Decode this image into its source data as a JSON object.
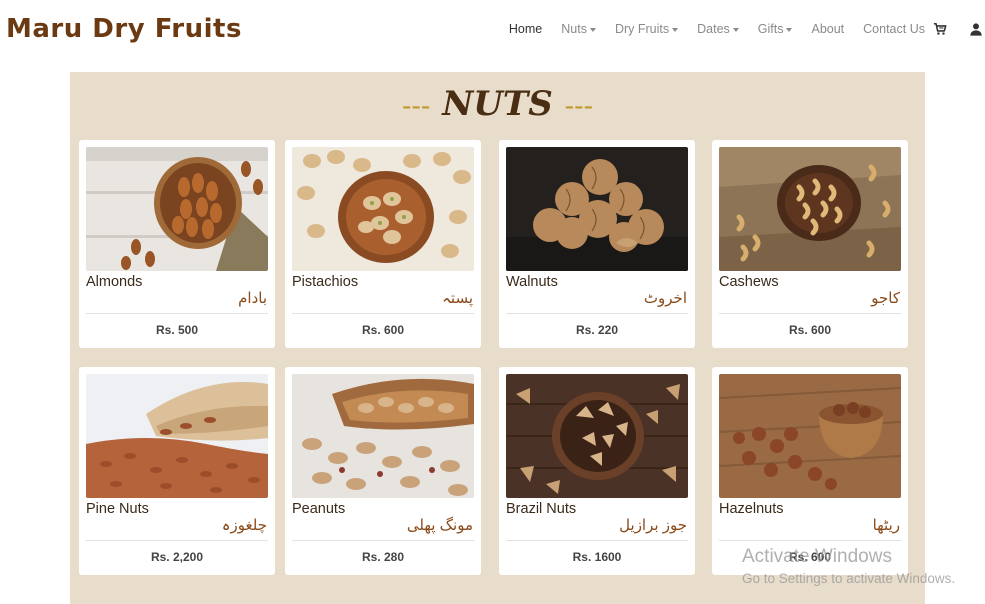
{
  "brand": "Maru Dry Fruits",
  "nav": {
    "home": "Home",
    "nuts": "Nuts",
    "dry_fruits": "Dry Fruits",
    "dates": "Dates",
    "gifts": "Gifts",
    "about": "About",
    "contact": "Contact Us"
  },
  "section": {
    "dash_left": "---",
    "title": "NUTS",
    "dash_right": "---"
  },
  "products": [
    {
      "name": "Almonds",
      "urdu": "بادام",
      "price": "Rs. 500"
    },
    {
      "name": "Pistachios",
      "urdu": "پستہ",
      "price": "Rs. 600"
    },
    {
      "name": "Walnuts",
      "urdu": "اخروٹ",
      "price": "Rs. 220"
    },
    {
      "name": "Cashews",
      "urdu": "کاجو",
      "price": "Rs. 600"
    },
    {
      "name": "Pine Nuts",
      "urdu": "چلغوزہ",
      "price": "Rs. 2,200"
    },
    {
      "name": "Peanuts",
      "urdu": "مونگ پھلی",
      "price": "Rs. 280"
    },
    {
      "name": "Brazil Nuts",
      "urdu": "جوز برازیل",
      "price": "Rs. 1600"
    },
    {
      "name": "Hazelnuts",
      "urdu": "ریٹھا",
      "price": "Rs. 600"
    }
  ],
  "watermark": {
    "line1": "Activate Windows",
    "line2": "Go to Settings to activate Windows."
  },
  "icons": {
    "cart": "cart-icon",
    "user": "user-icon"
  },
  "colors": {
    "brand": "#6b3a12",
    "section_bg": "#e8dccb",
    "title": "#4a2e14",
    "dash": "#c19a2e"
  }
}
